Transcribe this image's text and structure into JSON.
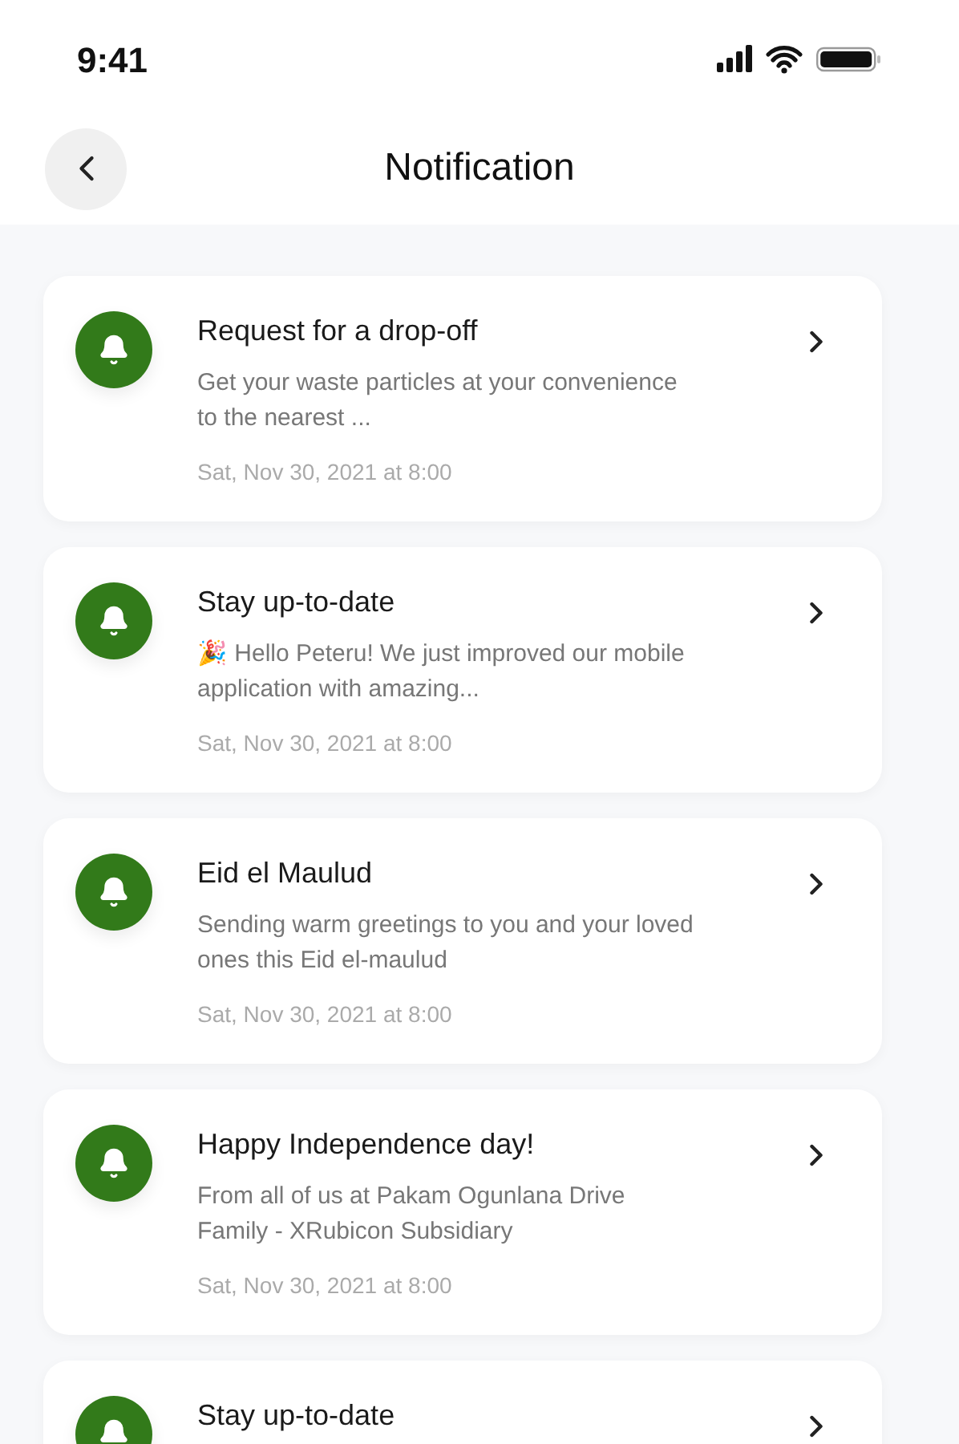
{
  "status_bar": {
    "time": "9:41"
  },
  "header": {
    "title": "Notification"
  },
  "notifications": [
    {
      "title": "Request for a drop-off",
      "body": "Get your waste particles at your convenience to the nearest ...",
      "date": "Sat, Nov 30, 2021 at 8:00"
    },
    {
      "title": "Stay up-to-date",
      "body": "🎉 Hello Peteru! We just improved our mobile application with amazing...",
      "date": "Sat, Nov 30, 2021 at 8:00"
    },
    {
      "title": "Eid el Maulud",
      "body": "Sending warm greetings to you and your loved ones this Eid el-maulud",
      "date": "Sat, Nov 30, 2021 at 8:00"
    },
    {
      "title": "Happy Independence day!",
      "body": "From all of us at Pakam Ogunlana Drive Family - XRubicon Subsidiary",
      "date": "Sat, Nov 30, 2021 at 8:00"
    },
    {
      "title": "Stay up-to-date"
    }
  ]
}
